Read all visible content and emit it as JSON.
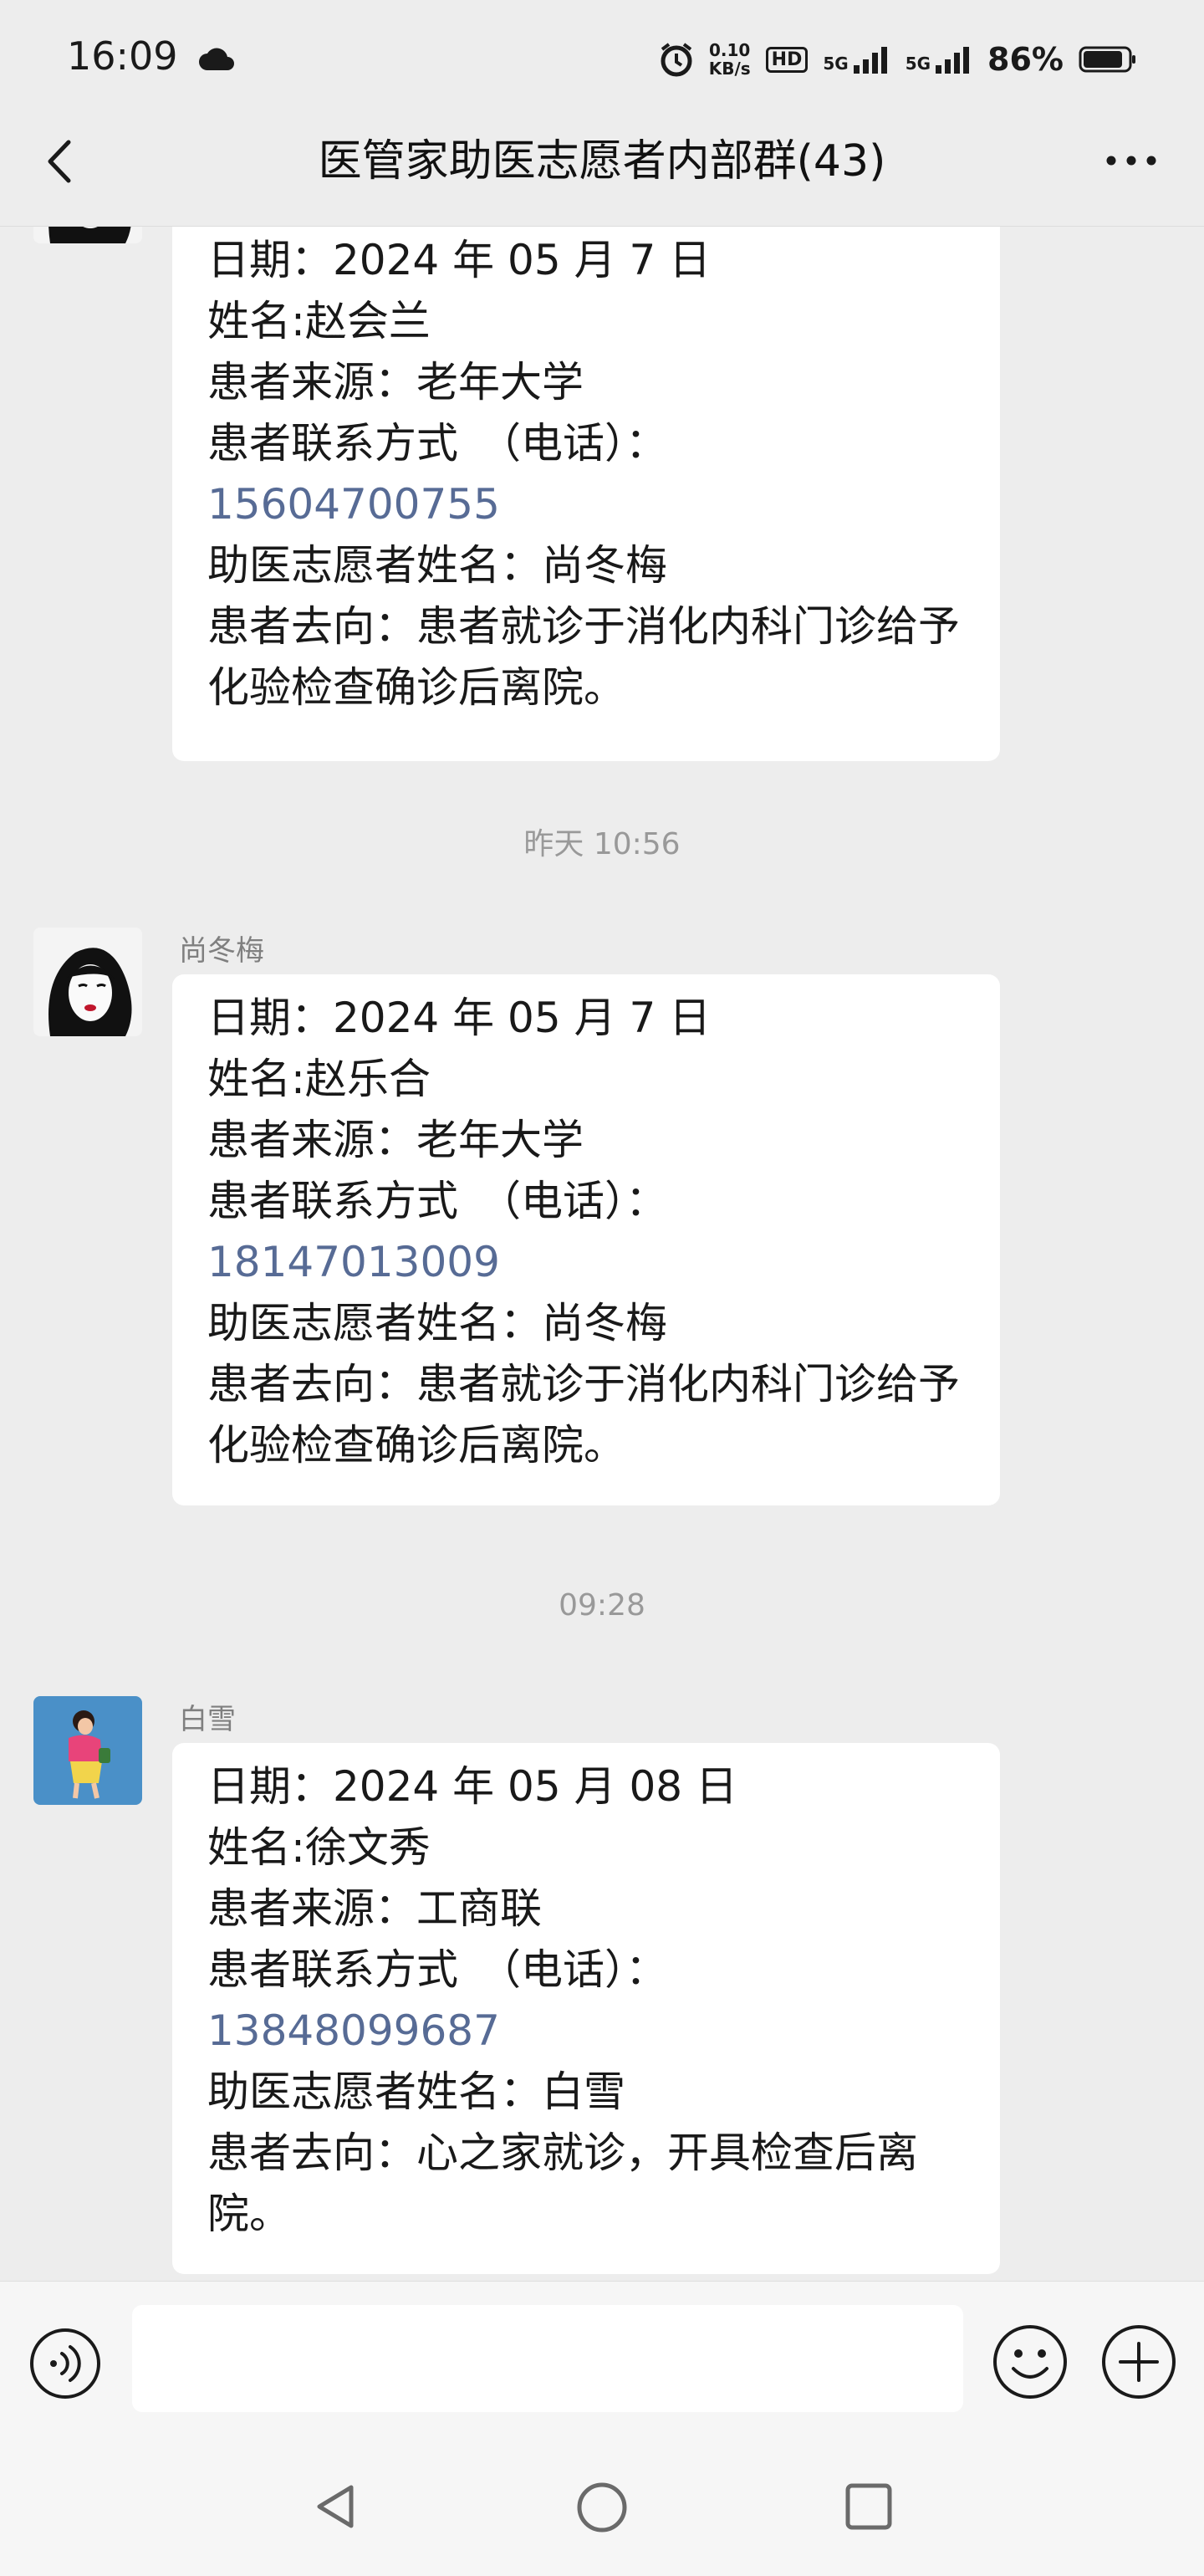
{
  "status_bar": {
    "time": "16:09",
    "net_speed_value": "0.10",
    "net_speed_unit": "KB/s",
    "hd_label": "HD",
    "network_1": "5G",
    "network_2": "5G",
    "battery": "86%"
  },
  "header": {
    "title": "医管家助医志愿者内部群(43)"
  },
  "messages": [
    {
      "lines": [
        "日期：2024 年 05 月 7 日",
        "姓名:赵会兰",
        "患者来源：老年大学",
        "患者联系方式　（电话）：",
        "15604700755",
        "助医志愿者姓名：尚冬梅",
        "患者去向：患者就诊于消化内科门诊给予化验检查确诊后离院。"
      ]
    },
    {
      "timestamp": "昨天 10:56",
      "sender": "尚冬梅",
      "lines": [
        "日期：2024 年 05 月 7 日",
        "姓名:赵乐合",
        "患者来源：老年大学",
        "患者联系方式　（电话）：",
        "18147013009",
        "助医志愿者姓名：尚冬梅",
        "患者去向：患者就诊于消化内科门诊给予化验检查确诊后离院。"
      ]
    },
    {
      "timestamp": "09:28",
      "sender": "白雪",
      "lines": [
        "日期：2024 年 05 月 08 日",
        "姓名:徐文秀",
        "患者来源：工商联",
        "患者联系方式　（电话）：",
        "13848099687",
        "助医志愿者姓名：白雪",
        "患者去向：心之家就诊，开具检查后离院。"
      ]
    }
  ],
  "input": {
    "value": "",
    "placeholder": ""
  },
  "colors": {
    "background": "#ededed",
    "bubble": "#ffffff",
    "link": "#576b95",
    "meta_text": "#999999"
  },
  "icons": [
    "cloud-icon",
    "alarm-icon",
    "signal-icon",
    "battery-icon",
    "back-icon",
    "more-icon",
    "voice-icon",
    "emoji-icon",
    "plus-icon",
    "nav-back-icon",
    "nav-home-icon",
    "nav-recents-icon"
  ]
}
